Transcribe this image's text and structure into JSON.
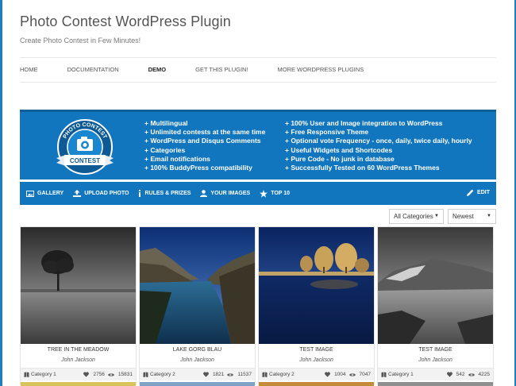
{
  "site": {
    "title": "Photo Contest WordPress Plugin",
    "tagline": "Create Photo Contest in Few Minutes!"
  },
  "nav": {
    "items": [
      "HOME",
      "DOCUMENTATION",
      "DEMO",
      "GET THIS PLUGIN!",
      "MORE WORDPRESS PLUGINS"
    ],
    "active": "DEMO"
  },
  "banner": {
    "badge_top_text": "PHOTO CONTEST",
    "badge_ribbon_text": "CONTEST",
    "features_left": [
      "+ Multilingual",
      "+ Unlimited contests at the same time",
      "+ WordPress and Disqus Comments",
      "+ Categories",
      "+ Email notifications",
      "+ 100% BuddyPress compatibility"
    ],
    "features_right": [
      "+ 100% User and Image integration to WordPress",
      "+ Free Responsive Theme",
      "+ Optional vote Frequency - once, daily, twice daily, hourly",
      "+ Useful Widgets and Shortcodes",
      "+ Pure Code - No junk in database",
      "+ Successfully Tested on 60 WordPress Themes"
    ],
    "colors": {
      "background": "#1276be",
      "text": "#ffffff"
    }
  },
  "contest_menu": {
    "gallery": "GALLERY",
    "upload": "UPLOAD PHOTO",
    "rules": "RULES & PRIZES",
    "your_images": "YOUR IMAGES",
    "top10": "TOP 10",
    "edit": "EDIT"
  },
  "filters": {
    "category": "All Categories",
    "sort": "Newest"
  },
  "photos": [
    {
      "title": "TREE IN THE MEADOW",
      "author": "John Jackson",
      "category": "Category 1",
      "likes": "2756",
      "views": "15831"
    },
    {
      "title": "LAKE GORG BLAU",
      "author": "John Jackson",
      "category": "Category 2",
      "likes": "1821",
      "views": "11537"
    },
    {
      "title": "TEST IMAGE",
      "author": "John Jackson",
      "category": "Category 2",
      "likes": "1004",
      "views": "7047"
    },
    {
      "title": "TEST IMAGE",
      "author": "John Jackson",
      "category": "Category 1",
      "likes": "542",
      "views": "4225"
    }
  ]
}
